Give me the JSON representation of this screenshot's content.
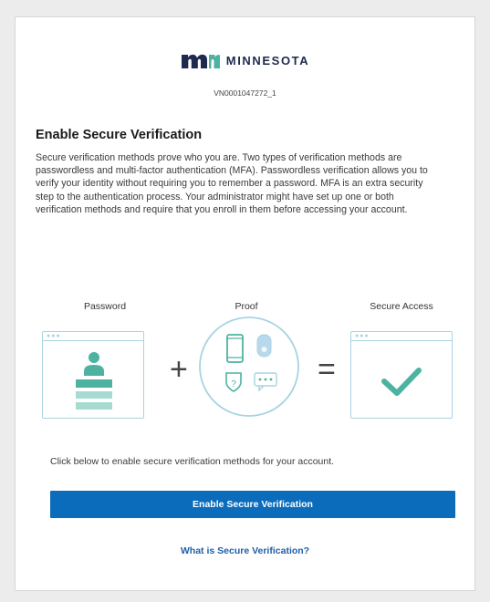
{
  "brand": {
    "logo_text": "MINNESOTA",
    "logo_color": "#1e2a4f",
    "accent_color": "#4db3a0"
  },
  "session_code": "VN0001047272_1",
  "title": "Enable Secure Verification",
  "description": "Secure verification methods prove who you are. Two types of verification methods are passwordless and multi-factor authentication (MFA). Passwordless verification allows you to verify your identity without requiring you to remember a password. MFA is an extra security step to the authentication process. Your administrator might have set up one or both verification methods and require that you enroll in them before accessing your account.",
  "illustration": {
    "password_label": "Password",
    "proof_label": "Proof",
    "secure_access_label": "Secure Access",
    "plus_symbol": "+",
    "equals_symbol": "=",
    "question_mark": "?",
    "outline_color": "#a8d3e3",
    "icon_color": "#4db3a0"
  },
  "prompt": "Click below to enable secure verification methods for your account.",
  "enable_button_label": "Enable Secure Verification",
  "button_color": "#0b6cbc",
  "help_link_label": "What is Secure Verification?"
}
